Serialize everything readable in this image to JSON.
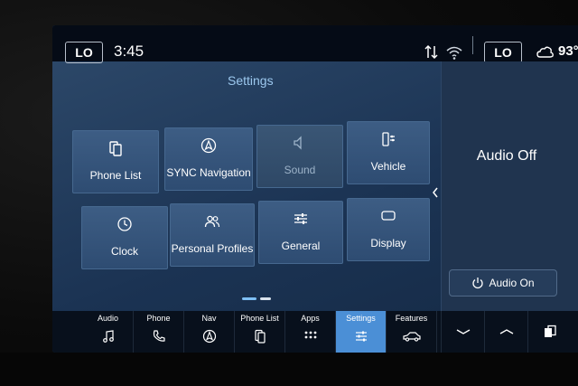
{
  "status": {
    "temp_left": "LO",
    "clock": "3:45",
    "temp_right": "LO",
    "weather_temp": "93°",
    "icons": [
      "mic-off-icon",
      "wifi-icon",
      "weather-icon"
    ]
  },
  "settings": {
    "title": "Settings",
    "tiles": [
      {
        "label": "Phone List",
        "icon": "phone-list-icon",
        "enabled": true
      },
      {
        "label": "SYNC Navigation",
        "icon": "navigation-icon",
        "enabled": true
      },
      {
        "label": "Sound",
        "icon": "speaker-icon",
        "enabled": false
      },
      {
        "label": "Vehicle",
        "icon": "vehicle-icon",
        "enabled": true
      },
      {
        "label": "Clock",
        "icon": "clock-icon",
        "enabled": true
      },
      {
        "label": "Personal Profiles",
        "icon": "profiles-icon",
        "enabled": true
      },
      {
        "label": "General",
        "icon": "sliders-icon",
        "enabled": true
      },
      {
        "label": "Display",
        "icon": "display-icon",
        "enabled": true
      }
    ],
    "page": {
      "current": 1,
      "total": 2
    }
  },
  "audio": {
    "status": "Audio Off",
    "button_label": "Audio On"
  },
  "nav": {
    "items": [
      {
        "label": "Audio",
        "icon": "music-note-icon"
      },
      {
        "label": "Phone",
        "icon": "phone-icon"
      },
      {
        "label": "Nav",
        "icon": "navigation-icon"
      },
      {
        "label": "Phone List",
        "icon": "phone-list-icon"
      },
      {
        "label": "Apps",
        "icon": "apps-grid-icon"
      },
      {
        "label": "Settings",
        "icon": "sliders-icon",
        "active": true
      },
      {
        "label": "Features",
        "icon": "car-icon"
      }
    ],
    "controls": [
      "chevron-down-icon",
      "chevron-up-icon",
      "copy-pages-icon"
    ]
  },
  "colors": {
    "accent": "#4b8fd6",
    "title": "#9cc8ee",
    "screen_bg": "#1b3353"
  }
}
